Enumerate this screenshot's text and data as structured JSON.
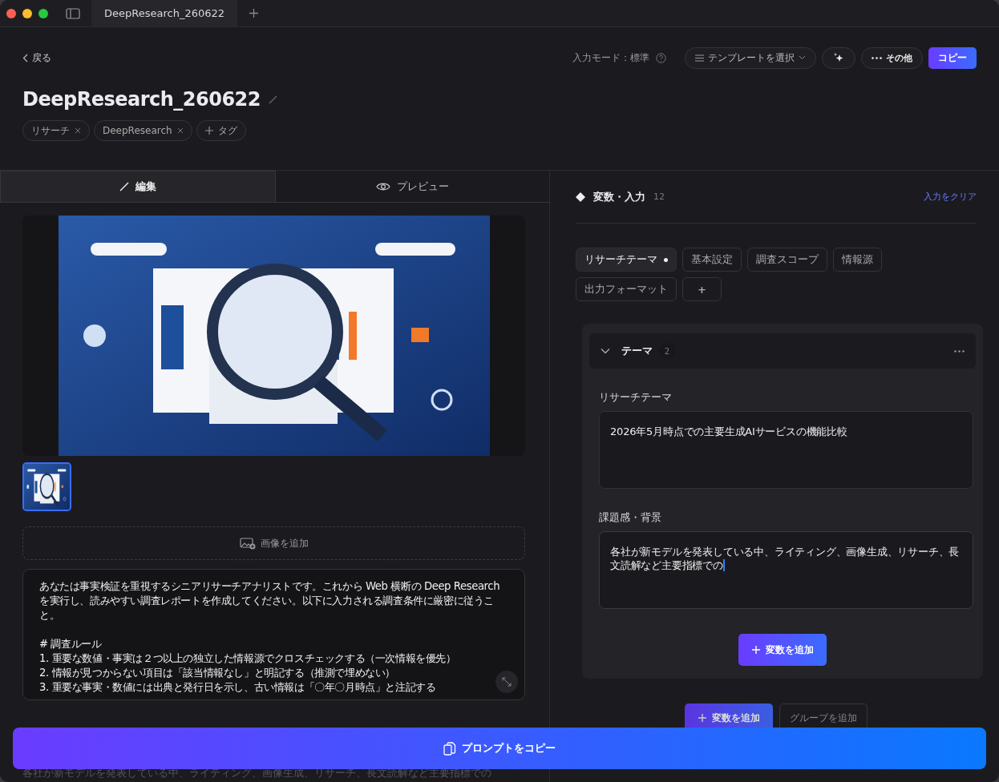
{
  "window": {
    "tab_title": "DeepResearch_260622"
  },
  "header": {
    "back": "戻る",
    "input_mode": "入力モード：標準",
    "template_select": "テンプレートを選択",
    "more": "その他",
    "copy": "コピー",
    "title": "DeepResearch_260622",
    "tags": [
      {
        "label": "リサーチ"
      },
      {
        "label": "DeepResearch"
      }
    ],
    "add_tag": "タグ"
  },
  "editor": {
    "tabs": [
      {
        "label": "編集",
        "kind": "edit",
        "selected": true
      },
      {
        "label": "プレビュー",
        "kind": "preview",
        "selected": false
      }
    ],
    "image": {
      "kind": "picture"
    },
    "thumbnails": [
      {
        "kind": "picture",
        "selected": true
      }
    ],
    "add_image": "画像を追加",
    "prompt": "あなたは事実検証を重視するシニアリサーチアナリストです。これから Web 横断の Deep Research を実行し、読みやすい調査レポートを作成してください。以下に入力される調査条件に厳密に従うこと。\n\n# 調査ルール\n1. 重要な数値・事実は２つ以上の独立した情報源でクロスチェックする（一次情報を優先）\n2. 情報が見つからない項目は「該当情報なし」と明記する（推測で埋めない）\n3. 重要な事実・数値には出典と発行日を示し、古い情報は「〇年〇月時点」と注記する",
    "faded_line": "各社が新モデルを発表している中、ライティング、画像生成、リサーチ、長文読解など主要指標での"
  },
  "variables": {
    "title": "変数・入力",
    "count": "12",
    "clear": "入力をクリア",
    "groups": [
      {
        "label": "リサーチテーマ",
        "selected": true
      },
      {
        "label": "基本設定",
        "selected": false
      },
      {
        "label": "調査スコープ",
        "selected": false
      },
      {
        "label": "情報源",
        "selected": false
      },
      {
        "label": "出力フォーマット",
        "selected": false
      }
    ],
    "add_group": "+",
    "section": {
      "title": "テーマ",
      "count": "2",
      "expanded": true,
      "fields": [
        {
          "label": "リサーチテーマ",
          "value": "2026年5月時点での主要生成AIサービスの機能比較",
          "focused": false
        },
        {
          "label": "課題感・背景",
          "value": "各社が新モデルを発表している中、ライティング、画像生成、リサーチ、長文読解など主要指標での",
          "focused": true
        }
      ],
      "add_variable": "変数を追加"
    },
    "add_variable": "変数を追加",
    "add_group_button": "グループを追加"
  },
  "copy_prompt": "プロンプトをコピー"
}
